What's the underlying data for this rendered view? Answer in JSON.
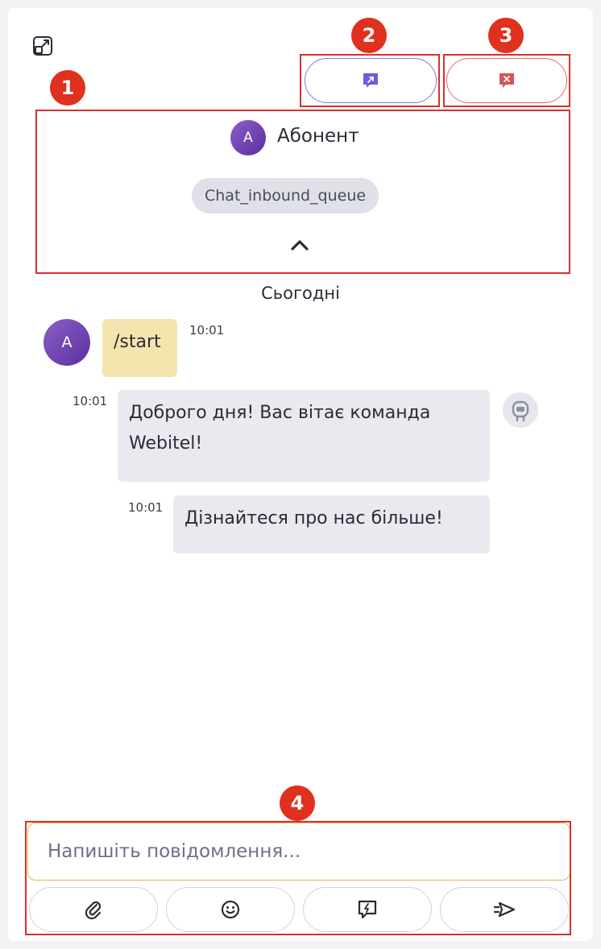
{
  "contact": {
    "name": "Абонент",
    "initial": "A",
    "queue": "Chat_inbound_queue"
  },
  "chat": {
    "date_separator": "Сьогодні",
    "messages": [
      {
        "sender": "client",
        "initial": "A",
        "text": "/start",
        "time": "10:01"
      },
      {
        "sender": "bot",
        "text": "Доброго дня! Вас вітає команда Webitel!",
        "time": "10:01"
      },
      {
        "sender": "bot",
        "text": "Дізнайтеся про нас більше!",
        "time": "10:01"
      }
    ]
  },
  "composer": {
    "placeholder": "Напишіть повідомлення..."
  },
  "annotations": [
    "1",
    "2",
    "3",
    "4"
  ],
  "icons": {
    "expand": "expand-icon",
    "transfer": "chat-transfer-icon",
    "close": "chat-close-icon",
    "collapse": "chevron-up-icon",
    "bot": "bot-icon",
    "attach": "paperclip-icon",
    "emoji": "emoji-icon",
    "quick_reply": "quick-reply-icon",
    "send": "send-icon"
  },
  "colors": {
    "accent": "#7b78e0",
    "danger": "#e36a6a",
    "client_bubble": "#f4e4ad",
    "bot_bubble": "#e9eaf0",
    "annotation": "#e0301e",
    "input_border": "#e8b54a"
  }
}
